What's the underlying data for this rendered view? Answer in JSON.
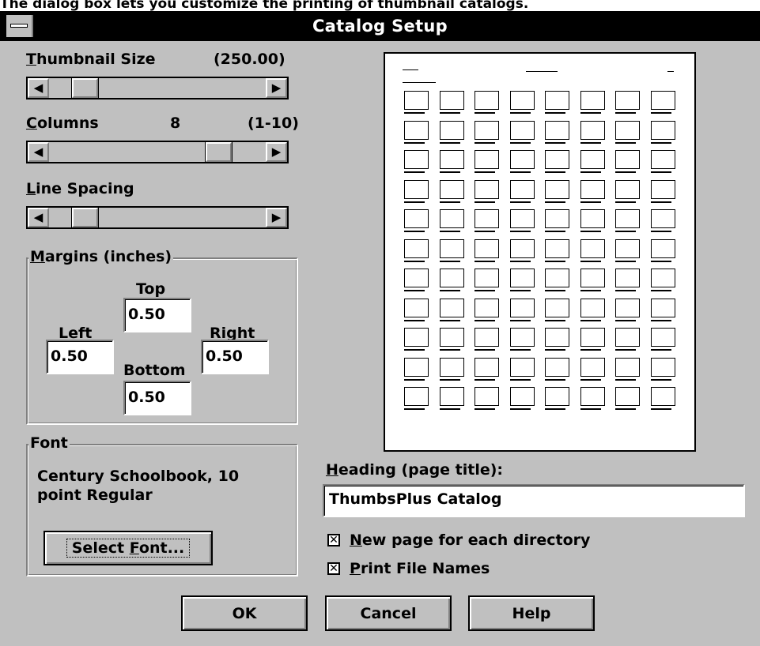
{
  "top_clip_text": "The dialog box lets you customize the printing of thumbnail catalogs.",
  "title": "Catalog Setup",
  "thumbnail_size": {
    "label_u": "T",
    "label_rest": "humbnail Size",
    "value": "(250.00)",
    "position": 0.12
  },
  "columns": {
    "label_u": "C",
    "label_rest": "olumns",
    "value": "8",
    "range": "(1-10)",
    "position": 0.78
  },
  "line_spacing": {
    "label_u": "L",
    "label_rest": "ine Spacing",
    "position": 0.12
  },
  "arrows": {
    "left": "◀",
    "right": "▶"
  },
  "margins": {
    "label_u": "M",
    "label_rest": "argins (inches)",
    "top_label": "Top",
    "top_value": "0.50",
    "left_label": "Left",
    "left_value": "0.50",
    "right_label": "Right",
    "right_value": "0.50",
    "bottom_label": "Bottom",
    "bottom_value": "0.50"
  },
  "font": {
    "label": "Font",
    "line1": "Century Schoolbook, 10",
    "line2": "point Regular",
    "button_pre": "Select ",
    "button_u": "F",
    "button_post": "ont..."
  },
  "heading": {
    "label_u": "H",
    "label_rest": "eading (page title):",
    "value": "ThumbsPlus Catalog"
  },
  "options": [
    {
      "u": "N",
      "rest": "ew page for each directory",
      "checked": true
    },
    {
      "u": "P",
      "rest": "rint File Names",
      "checked": true
    }
  ],
  "buttons": {
    "ok": "OK",
    "cancel": "Cancel",
    "help": "Help"
  },
  "preview": {
    "columns": 8,
    "rows": 11
  }
}
